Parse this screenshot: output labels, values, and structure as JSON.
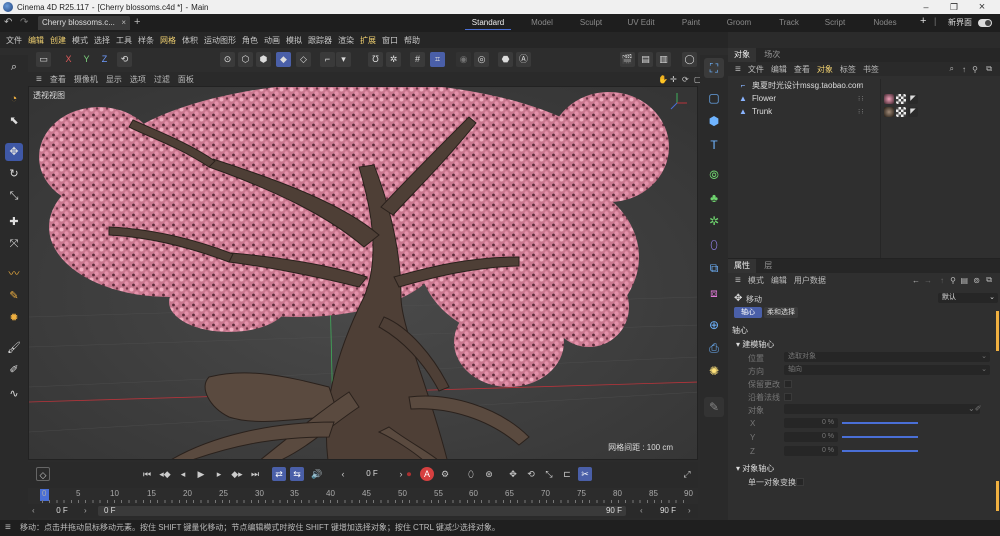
{
  "titlebar": {
    "app": "Cinema 4D R25.117",
    "document": "[Cherry blossoms.c4d *]",
    "view": "Main"
  },
  "tabs": {
    "doc_tab": "Cherry blossoms.c...",
    "layouts": [
      "Standard",
      "Model",
      "Sculpt",
      "UV Edit",
      "Paint",
      "Groom",
      "Track",
      "Script",
      "Nodes"
    ],
    "active_layout": "Standard",
    "new_ui": "新界面"
  },
  "menubar": [
    "文件",
    "编辑",
    "创建",
    "模式",
    "选择",
    "工具",
    "样条",
    "网格",
    "体积",
    "运动图形",
    "角色",
    "动画",
    "模拟",
    "跟踪器",
    "渲染",
    "扩展",
    "窗口",
    "帮助"
  ],
  "toolbar": {
    "axis_x": "X",
    "axis_y": "Y",
    "axis_z": "Z"
  },
  "viewport": {
    "menu": [
      "查看",
      "摄像机",
      "显示",
      "选项",
      "过滤",
      "面板"
    ],
    "view_label": "透视视图",
    "grid_spacing": "网格间距 : 100 cm"
  },
  "object_manager": {
    "tabs": [
      "对象",
      "场次"
    ],
    "menu": [
      "文件",
      "编辑",
      "查看",
      "对象",
      "标签",
      "书签"
    ],
    "objects": [
      {
        "name": "奥夏时光设计mssg.taobao.com",
        "icon": "null-object-icon"
      },
      {
        "name": "Flower",
        "icon": "polygon-object-icon"
      },
      {
        "name": "Trunk",
        "icon": "polygon-object-icon"
      }
    ]
  },
  "attributes": {
    "tabs": [
      "属性",
      "层"
    ],
    "menu": [
      "模式",
      "编辑",
      "用户数据"
    ],
    "tool": "移动",
    "preset": "默认",
    "subtabs": [
      "轴心",
      "柔和选择"
    ],
    "section_title": "轴心",
    "group_build": "建模轴心",
    "position_label": "位置",
    "position_value": "选取对象",
    "direction_label": "方向",
    "direction_value": "轴向",
    "keep_changes": "保留更改",
    "along_normals": "沿着法线",
    "object_label": "对象",
    "x_label": "X",
    "x_value": "0 %",
    "y_label": "Y",
    "y_value": "0 %",
    "z_label": "Z",
    "z_value": "0 %",
    "group_object": "对象轴心",
    "single_object": "单一对象变换"
  },
  "timeline": {
    "current_frame": "0 F",
    "ruler": [
      "0",
      "5",
      "10",
      "15",
      "20",
      "25",
      "30",
      "35",
      "40",
      "45",
      "50",
      "55",
      "60",
      "65",
      "70",
      "75",
      "80",
      "85",
      "90"
    ],
    "range_start": "0 F",
    "range_min": "0 F",
    "range_max": "90 F",
    "range_end": "90 F"
  },
  "status": "移动：点击并拖动鼠标移动元素。按住 SHIFT 键量化移动；节点编辑模式时按住 SHIFT 键增加选择对象；按住 CTRL 键减少选择对象。",
  "colors": {
    "accent": "#4a6fd6",
    "blossom": "#e08aa6",
    "bark": "#4e3f36",
    "highlight": "#f0d070"
  }
}
